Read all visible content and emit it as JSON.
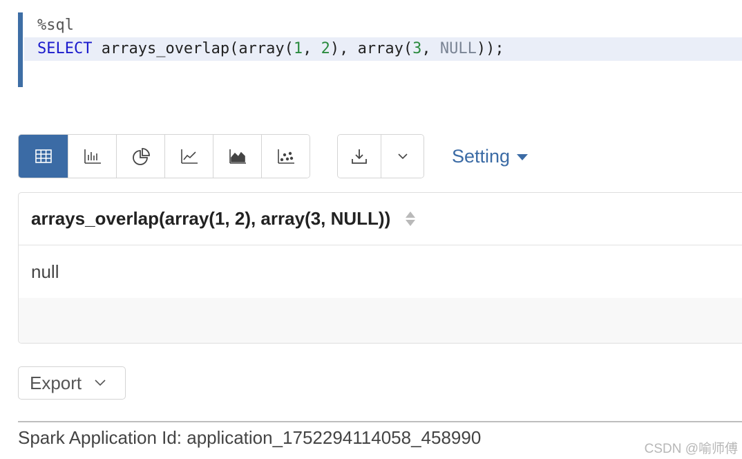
{
  "editor": {
    "magic": "%sql",
    "kw_select": "SELECT",
    "fn_part1": " arrays_overlap(array(",
    "num1": "1",
    "sep1": ", ",
    "num2": "2",
    "fn_part2": "), array(",
    "num3": "3",
    "sep2": ", ",
    "null_kw": "NULL",
    "fn_end": "));"
  },
  "toolbar": {
    "viz_buttons": [
      {
        "icon": "table-icon",
        "active": true
      },
      {
        "icon": "bar-chart-icon",
        "active": false
      },
      {
        "icon": "pie-chart-icon",
        "active": false
      },
      {
        "icon": "line-chart-icon",
        "active": false
      },
      {
        "icon": "area-chart-icon",
        "active": false
      },
      {
        "icon": "scatter-chart-icon",
        "active": false
      }
    ],
    "download_icon": "download-icon",
    "dropdown_icon": "chevron-down-icon",
    "setting_label": "Setting",
    "accent_color": "#3b6ba5"
  },
  "table": {
    "column_header": "arrays_overlap(array(1, 2), array(3, NULL))",
    "rows": [
      [
        "null"
      ]
    ]
  },
  "export": {
    "label": "Export"
  },
  "footer": {
    "app_id_text": "Spark Application Id: application_1752294114058_458990"
  },
  "watermark": "CSDN @喻师傅"
}
